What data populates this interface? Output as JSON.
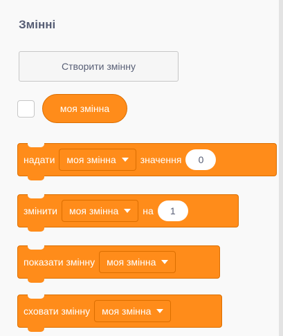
{
  "palette": {
    "title": "Змінні",
    "create_variable_label": "Створити змінну",
    "variable_reporter": "моя змінна"
  },
  "blocks": {
    "set": {
      "label": "надати",
      "variable": "моя змінна",
      "to_label": "значення",
      "value": "0"
    },
    "change": {
      "label": "змінити",
      "variable": "моя змінна",
      "by_label": "на",
      "value": "1"
    },
    "show": {
      "label": "показати змінну",
      "variable": "моя змінна"
    },
    "hide": {
      "label": "сховати змінну",
      "variable": "моя змінна"
    }
  },
  "icons": {
    "dropdown": "chevron-down-icon"
  },
  "colors": {
    "block": "#ff8c1a",
    "block_border": "#db6e00",
    "title_text": "#575e75"
  }
}
